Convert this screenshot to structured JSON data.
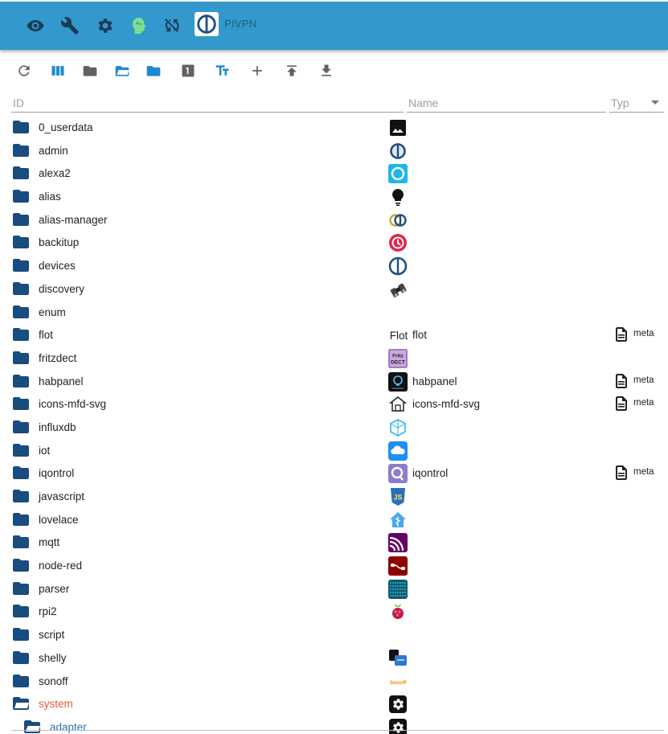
{
  "app": {
    "name": "PIVPN",
    "colors": {
      "appbar": "#3399cc",
      "folder": "#194c7f",
      "selected": "#e05b3e",
      "child": "#2f6fb5"
    }
  },
  "topbar_icons": [
    "eye-icon",
    "wrench-icon",
    "gear-icon",
    "brain-head-icon",
    "sync-off-icon",
    "iobroker-logo"
  ],
  "toolbar_icons": [
    "refresh-icon",
    "columns-icon",
    "folder-closed-icon",
    "folder-open-icon",
    "folder-icon",
    "number-one-icon",
    "text-size-icon",
    "add-icon",
    "upload-icon",
    "download-icon"
  ],
  "headers": {
    "id_placeholder": "ID",
    "name_placeholder": "Name",
    "type_placeholder": "Typ"
  },
  "rows": [
    {
      "id": "0_userdata",
      "icon": "image-icon",
      "name": "",
      "type": ""
    },
    {
      "id": "admin",
      "icon": "iobroker-admin-icon",
      "name": "",
      "type": ""
    },
    {
      "id": "alexa2",
      "icon": "alexa-icon",
      "name": "",
      "type": ""
    },
    {
      "id": "alias",
      "icon": "lightbulb-icon",
      "name": "",
      "type": ""
    },
    {
      "id": "alias-manager",
      "icon": "alias-manager-icon",
      "name": "",
      "type": ""
    },
    {
      "id": "backitup",
      "icon": "backitup-icon",
      "name": "",
      "type": ""
    },
    {
      "id": "devices",
      "icon": "iobroker-devices-icon",
      "name": "",
      "type": ""
    },
    {
      "id": "discovery",
      "icon": "binoculars-icon",
      "name": "",
      "type": ""
    },
    {
      "id": "enum",
      "icon": "",
      "name": "",
      "type": ""
    },
    {
      "id": "flot",
      "icon": "flot-icon",
      "name": "flot",
      "type": "meta"
    },
    {
      "id": "fritzdect",
      "icon": "fritzdect-icon",
      "name": "",
      "type": ""
    },
    {
      "id": "habpanel",
      "icon": "habpanel-icon",
      "name": "habpanel",
      "type": "meta"
    },
    {
      "id": "icons-mfd-svg",
      "icon": "house-icon",
      "name": "icons-mfd-svg",
      "type": "meta"
    },
    {
      "id": "influxdb",
      "icon": "influxdb-icon",
      "name": "",
      "type": ""
    },
    {
      "id": "iot",
      "icon": "cloud-icon",
      "name": "",
      "type": ""
    },
    {
      "id": "iqontrol",
      "icon": "iqontrol-icon",
      "name": "iqontrol",
      "type": "meta"
    },
    {
      "id": "javascript",
      "icon": "javascript-icon",
      "name": "",
      "type": ""
    },
    {
      "id": "lovelace",
      "icon": "lovelace-icon",
      "name": "",
      "type": ""
    },
    {
      "id": "mqtt",
      "icon": "mqtt-icon",
      "name": "",
      "type": ""
    },
    {
      "id": "node-red",
      "icon": "node-red-icon",
      "name": "",
      "type": ""
    },
    {
      "id": "parser",
      "icon": "parser-icon",
      "name": "",
      "type": ""
    },
    {
      "id": "rpi2",
      "icon": "raspberry-icon",
      "name": "",
      "type": ""
    },
    {
      "id": "script",
      "icon": "",
      "name": "",
      "type": ""
    },
    {
      "id": "shelly",
      "icon": "shelly-icon",
      "name": "",
      "type": ""
    },
    {
      "id": "sonoff",
      "icon": "sonoff-icon",
      "name": "",
      "type": ""
    },
    {
      "id": "system",
      "icon": "system-gear-icon",
      "name": "",
      "type": "",
      "state": "open"
    },
    {
      "id": "adapter",
      "icon": "system-gear-icon",
      "name": "",
      "type": "",
      "state": "child"
    }
  ],
  "icon_labels": {
    "fritzdect_line1": "Fritz",
    "fritzdect_line2": "DECT",
    "flot_text": "Flot",
    "sonoff_text": "Sonoff",
    "js_text": "JS"
  }
}
